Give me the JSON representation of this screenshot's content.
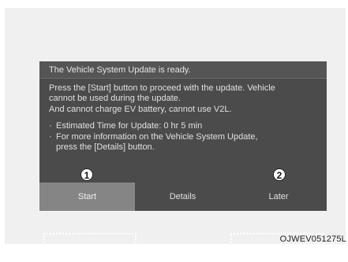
{
  "dialog": {
    "title": "The Vehicle System Update is ready.",
    "line1": "Press the [Start] button to proceed with the update. Vehicle",
    "line2": "cannot be used during the update.",
    "line3": "And cannot charge EV battery, cannot use V2L.",
    "bullet_symbol": "·",
    "bullet1": "Estimated Time for Update: 0 hr 5 min",
    "bullet2_line1": "For more information on the Vehicle System Update,",
    "bullet2_line2": "press the [Details] button."
  },
  "buttons": {
    "start": "Start",
    "details": "Details",
    "later": "Later"
  },
  "callouts": {
    "one": "1",
    "two": "2"
  },
  "caption": "OJWEV051275L",
  "colors": {
    "dialog_bg": "#4b4b4b",
    "selected_button_bg": "#858585",
    "text": "#e4e4e4",
    "highlight_border": "#ffffff"
  }
}
